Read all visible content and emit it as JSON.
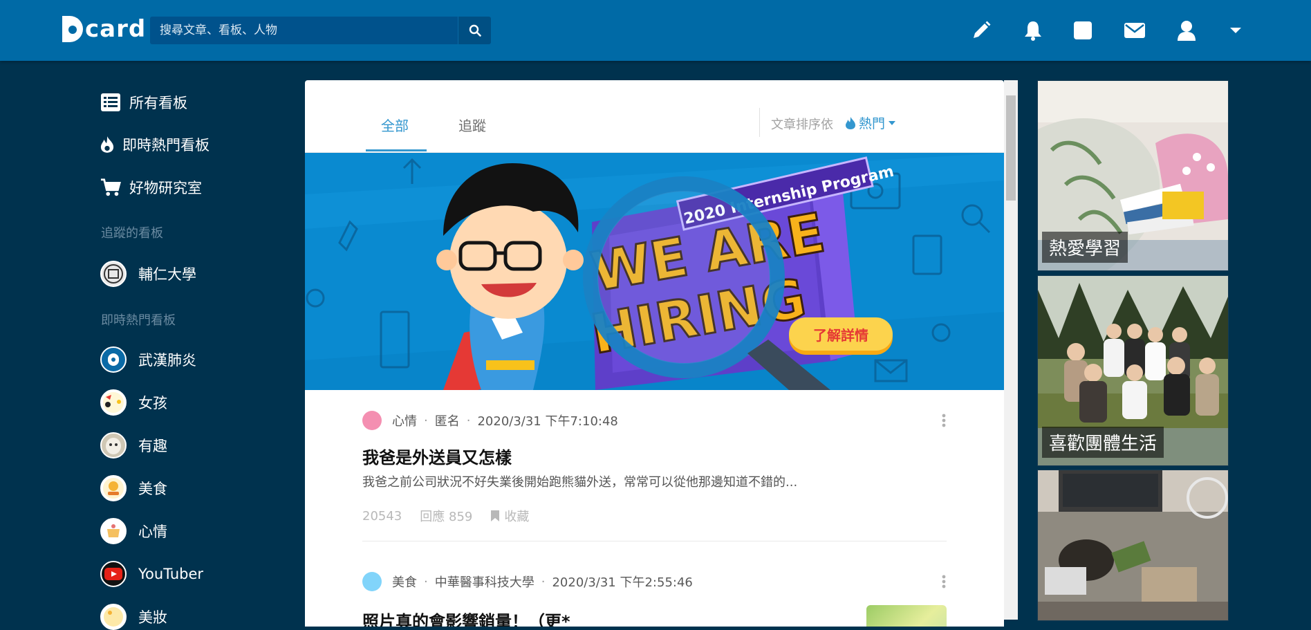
{
  "header": {
    "logo_text": "card",
    "search_placeholder": "搜尋文章、看板、人物",
    "icons": [
      "search-icon",
      "pencil-icon",
      "bell-icon",
      "card-icon",
      "mail-icon",
      "user-icon",
      "caret-down-icon"
    ]
  },
  "sidebar": {
    "main_items": [
      {
        "label": "所有看板",
        "icon": "list-icon"
      },
      {
        "label": "即時熱門看板",
        "icon": "flame-icon"
      },
      {
        "label": "好物研究室",
        "icon": "cart-icon"
      }
    ],
    "followed_heading": "追蹤的看板",
    "followed": [
      {
        "label": "輔仁大學"
      }
    ],
    "hot_heading": "即時熱門看板",
    "hot": [
      {
        "label": "武漢肺炎"
      },
      {
        "label": "女孩"
      },
      {
        "label": "有趣"
      },
      {
        "label": "美食"
      },
      {
        "label": "心情"
      },
      {
        "label": "YouTuber"
      },
      {
        "label": "美妝"
      }
    ]
  },
  "main": {
    "tabs": [
      {
        "label": "全部"
      },
      {
        "label": "追蹤"
      }
    ],
    "sort_label": "文章排序依",
    "sort_value": "熱門",
    "banner": {
      "program": "2020 Internship Program",
      "headline_1": "WE ARE",
      "headline_2": "HIRING",
      "cta": "了解詳情"
    },
    "posts": [
      {
        "board": "心情",
        "author": "匿名",
        "time": "2020/3/31 下午7:10:48",
        "title": "我爸是外送員又怎樣",
        "excerpt": "我爸之前公司狀況不好失業後開始跑熊貓外送，常常可以從他那邊知道不錯的...",
        "likes": "20543",
        "comments": "回應 859",
        "save": "收藏",
        "dot_color": "#f48fb1"
      },
      {
        "board": "美食",
        "author": "中華醫事科技大學",
        "time": "2020/3/31 下午2:55:46",
        "title": "照片真的會影響銷量！（更*",
        "dot_color": "#81d4fa"
      }
    ]
  },
  "ads": [
    {
      "caption": "熱愛學習"
    },
    {
      "caption": "喜歡團體生活"
    },
    {
      "caption": ""
    }
  ]
}
